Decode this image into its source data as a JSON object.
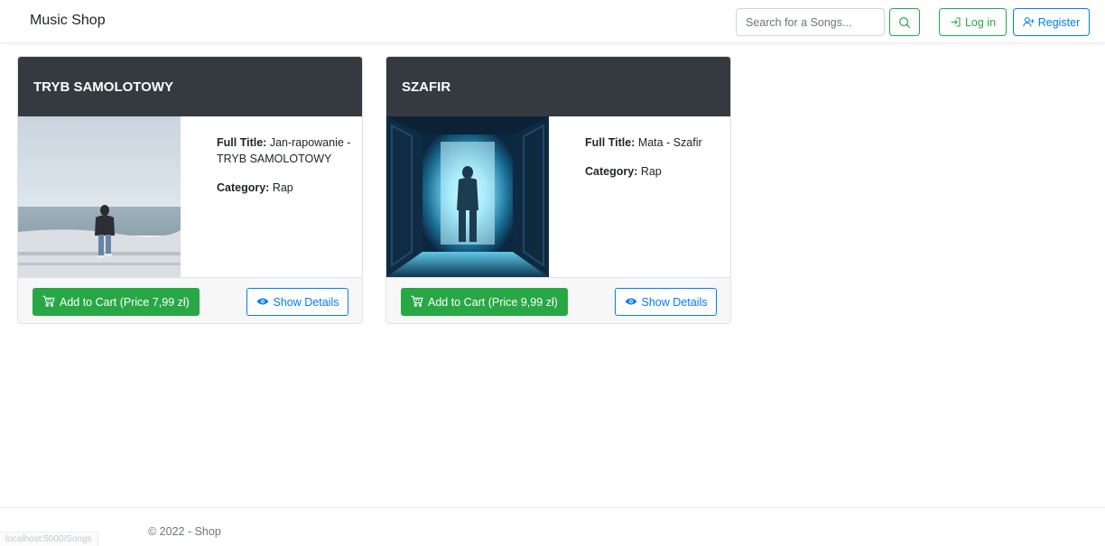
{
  "navbar": {
    "brand": "Music Shop",
    "search_placeholder": "Search for a Songs...",
    "login_label": "Log in",
    "register_label": "Register"
  },
  "products": [
    {
      "title": "TRYB SAMOLOTOWY",
      "full_title_label": "Full Title:",
      "full_title": "Jan-rapowanie - TRYB SAMOLOTOWY",
      "category_label": "Category:",
      "category": "Rap",
      "cart_label": "Add to Cart (Price 7,99 zł)",
      "details_label": "Show Details"
    },
    {
      "title": "SZAFIR",
      "full_title_label": "Full Title:",
      "full_title": "Mata - Szafir",
      "category_label": "Category:",
      "category": "Rap",
      "cart_label": "Add to Cart (Price 9,99 zł)",
      "details_label": "Show Details"
    }
  ],
  "footer": {
    "copyright": "© 2022 - Shop"
  },
  "status_bar": {
    "url": "localhost:5000/Songs"
  },
  "colors": {
    "success": "#28a745",
    "primary": "#007bff",
    "card_header": "#343a40"
  },
  "icons": {
    "search": "search-icon",
    "login": "login-icon",
    "register": "user-plus-icon",
    "cart": "cart-icon",
    "details": "eye-icon"
  }
}
